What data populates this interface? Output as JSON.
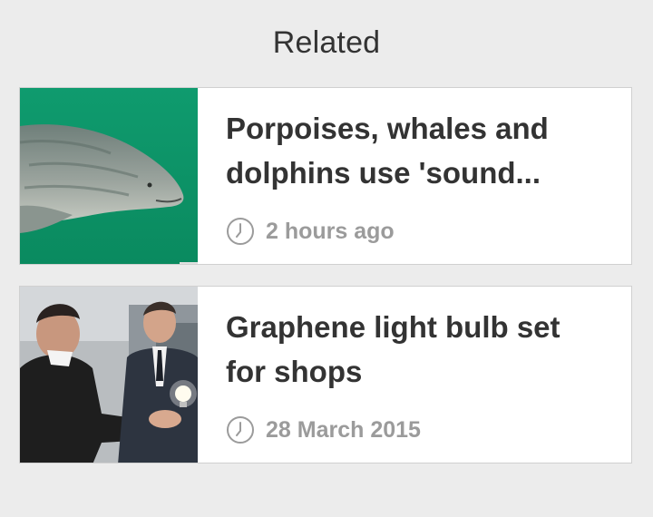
{
  "section": {
    "title": "Related"
  },
  "articles": [
    {
      "headline": "Porpoises, whales and dolphins use 'sound...",
      "timestamp": "2 hours ago",
      "thumbnail_icon": "porpoise-photo"
    },
    {
      "headline": "Graphene light bulb set for shops",
      "timestamp": "28 March 2015",
      "thumbnail_icon": "graphene-bulb-photo"
    }
  ],
  "colors": {
    "background": "#ececec",
    "card": "#ffffff",
    "headline": "#333333",
    "timestamp": "#9b9b9b",
    "water": "#0e9a6c"
  }
}
